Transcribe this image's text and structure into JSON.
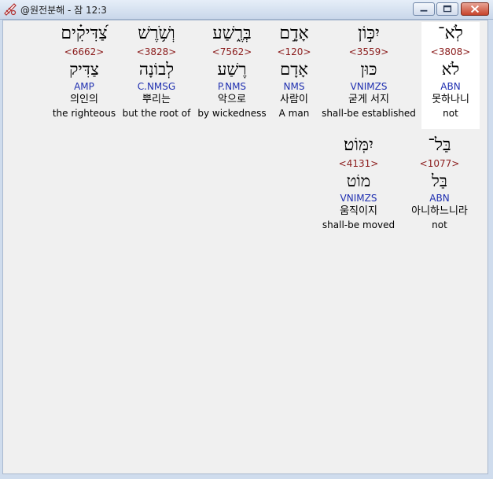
{
  "window": {
    "title": "@원전분해 - 잠 12:3"
  },
  "words": [
    {
      "hebrew": "לֹֽא־",
      "strong": "<3808>",
      "lemma": "לֹא",
      "morph": "ABN",
      "korean": "못하나니",
      "english": "not",
      "selected": true
    },
    {
      "hebrew": "יִכּ֣וֹן",
      "strong": "<3559>",
      "lemma": "כּוּן",
      "morph": "VNIMZS",
      "korean": "굳게 서지",
      "english": "shall-be established",
      "selected": false
    },
    {
      "hebrew": "אָדָ֣ם",
      "strong": "<120>",
      "lemma": "אָדָם",
      "morph": "NMS",
      "korean": "사람이",
      "english": "A man",
      "selected": false
    },
    {
      "hebrew": "בְּרֶ֑שַׁע",
      "strong": "<7562>",
      "lemma": "רֶשַׁע",
      "morph": "P.NMS",
      "korean": "악으로",
      "english": "by wickedness",
      "selected": false
    },
    {
      "hebrew": "וְשֹׁ֥רֶשׁ",
      "strong": "<3828>",
      "lemma": "לְבוֹנָה",
      "morph": "C.NMSG",
      "korean": "뿌리는",
      "english": "but the root of",
      "selected": false
    },
    {
      "hebrew": "צַ֝דִּיקִ֗ים",
      "strong": "<6662>",
      "lemma": "צַדִּיק",
      "morph": "AMP",
      "korean": "의인의",
      "english": "the righteous",
      "selected": false
    },
    {
      "hebrew": "בַּל־",
      "strong": "<1077>",
      "lemma": "בַּל",
      "morph": "ABN",
      "korean": "아니하느니라",
      "english": "not",
      "selected": false
    },
    {
      "hebrew": "יִמּֽוֹט׃",
      "strong": "<4131>",
      "lemma": "מוֹט",
      "morph": "VNIMZS",
      "korean": "움직이지",
      "english": "shall-be moved",
      "selected": false
    }
  ]
}
